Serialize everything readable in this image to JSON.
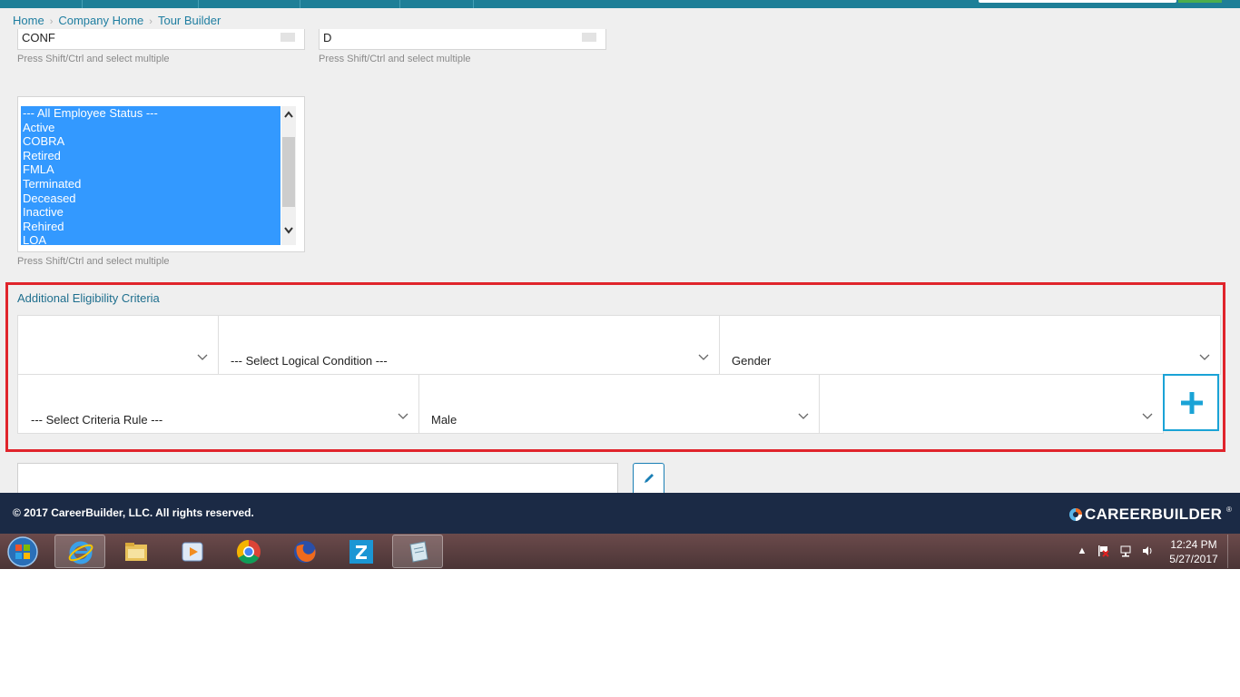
{
  "breadcrumb": {
    "home": "Home",
    "company_home": "Company Home",
    "tour_builder": "Tour Builder"
  },
  "top_selects": [
    {
      "value": "CONF",
      "help": "Press Shift/Ctrl and select multiple"
    },
    {
      "value": "D",
      "help": "Press Shift/Ctrl and select multiple"
    }
  ],
  "employee_status": {
    "options": [
      "--- All Employee Status ---",
      "Active",
      "COBRA",
      "Retired",
      "FMLA",
      "Terminated",
      "Deceased",
      "Inactive",
      "Rehired",
      "LOA"
    ],
    "help": "Press Shift/Ctrl and select multiple"
  },
  "criteria": {
    "title": "Additional Eligibility Criteria",
    "row1": {
      "operator": "",
      "logical_condition": "--- Select Logical Condition ---",
      "field": "Gender"
    },
    "row2": {
      "criteria_rule": "--- Select Criteria Rule ---",
      "value": "Male",
      "extra": ""
    },
    "add_icon": "plus-icon"
  },
  "edit_icon": "pencil-icon",
  "footer": {
    "copyright": "© 2017 CareerBuilder, LLC. All rights reserved.",
    "logo": "CAREERBUILDER",
    "logo_reg": "®"
  },
  "taskbar": {
    "apps": [
      "internet-explorer",
      "file-explorer",
      "media-player",
      "chrome",
      "firefox",
      "zoom",
      "notes"
    ],
    "time": "12:24 PM",
    "date": "5/27/2017"
  },
  "colors": {
    "brand_teal": "#1e7f97",
    "selection_blue": "#3399ff",
    "highlight_red": "#e0242b",
    "footer_navy": "#1b2a45"
  }
}
